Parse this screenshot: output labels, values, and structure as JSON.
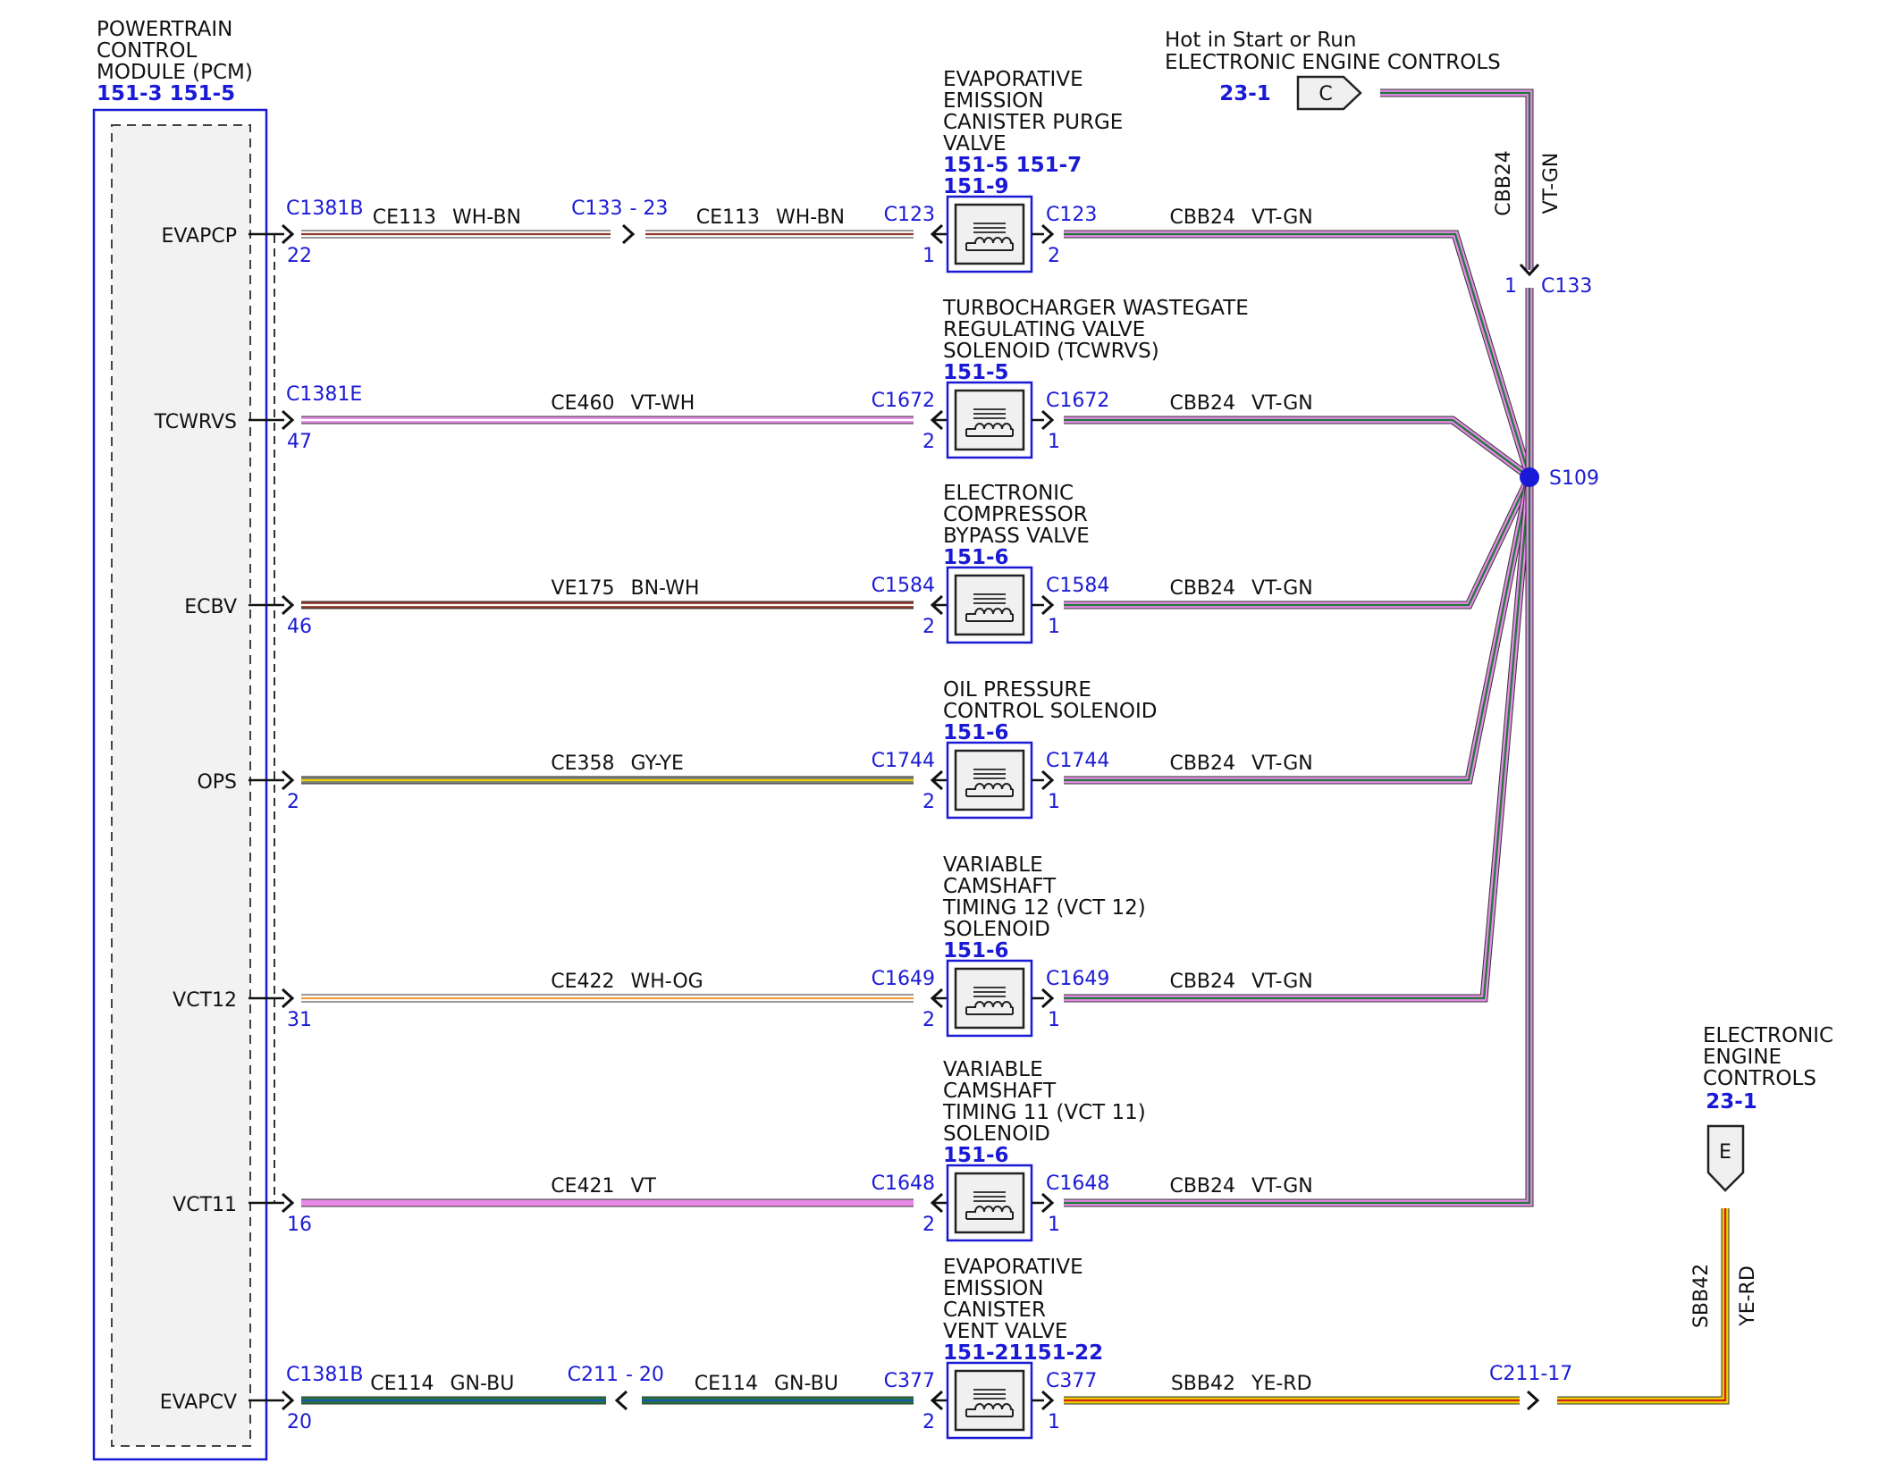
{
  "pcm": {
    "title": [
      "POWERTRAIN",
      "CONTROL",
      "MODULE (PCM)"
    ],
    "refs": "151-3 151-5"
  },
  "wire_colors": {
    "WH": "#ffffff",
    "BN": "#8b3a2a",
    "VT": "#e68ae6",
    "GN": "#1f7a3a",
    "GY": "#808080",
    "YE": "#e8d300",
    "OG": "#f2a040",
    "BU": "#1f4fb0",
    "RD": "#d81f1f"
  },
  "circuits": [
    {
      "pin_label": "EVAPCP",
      "pcm_conn": "C1381B",
      "pcm_pin": "22",
      "segments": [
        {
          "circuit": "CE113",
          "color": "WH-BN"
        },
        {
          "circuit": "CE113",
          "color": "WH-BN"
        }
      ],
      "inline": {
        "name": "C133",
        "pin": "23"
      },
      "component": {
        "name": [
          "EVAPORATIVE",
          "EMISSION",
          "CANISTER PURGE",
          "VALVE"
        ],
        "refs": [
          "151-5 151-7",
          "151-9"
        ],
        "conn": "C123",
        "pin_in": "1",
        "pin_out": "2"
      },
      "return": {
        "circuit": "CBB24",
        "color": "VT-GN"
      }
    },
    {
      "pin_label": "TCWRVS",
      "pcm_conn": "C1381E",
      "pcm_pin": "47",
      "segments": [
        {
          "circuit": "CE460",
          "color": "VT-WH"
        }
      ],
      "component": {
        "name": [
          "TURBOCHARGER WASTEGATE",
          "REGULATING VALVE",
          "SOLENOID (TCWRVS)"
        ],
        "refs": [
          "151-5"
        ],
        "conn": "C1672",
        "pin_in": "2",
        "pin_out": "1"
      },
      "return": {
        "circuit": "CBB24",
        "color": "VT-GN"
      }
    },
    {
      "pin_label": "ECBV",
      "pcm_pin": "46",
      "segments": [
        {
          "circuit": "VE175",
          "color": "BN-WH"
        }
      ],
      "component": {
        "name": [
          "ELECTRONIC",
          "COMPRESSOR",
          "BYPASS VALVE"
        ],
        "refs": [
          "151-6"
        ],
        "conn": "C1584",
        "pin_in": "2",
        "pin_out": "1"
      },
      "return": {
        "circuit": "CBB24",
        "color": "VT-GN"
      }
    },
    {
      "pin_label": "OPS",
      "pcm_pin": "2",
      "segments": [
        {
          "circuit": "CE358",
          "color": "GY-YE"
        }
      ],
      "component": {
        "name": [
          "OIL PRESSURE",
          "CONTROL SOLENOID"
        ],
        "refs": [
          "151-6"
        ],
        "conn": "C1744",
        "pin_in": "2",
        "pin_out": "1"
      },
      "return": {
        "circuit": "CBB24",
        "color": "VT-GN"
      }
    },
    {
      "pin_label": "VCT12",
      "pcm_pin": "31",
      "segments": [
        {
          "circuit": "CE422",
          "color": "WH-OG"
        }
      ],
      "component": {
        "name": [
          "VARIABLE",
          "CAMSHAFT",
          "TIMING 12 (VCT 12)",
          "SOLENOID"
        ],
        "refs": [
          "151-6"
        ],
        "conn": "C1649",
        "pin_in": "2",
        "pin_out": "1"
      },
      "return": {
        "circuit": "CBB24",
        "color": "VT-GN"
      }
    },
    {
      "pin_label": "VCT11",
      "pcm_pin": "16",
      "segments": [
        {
          "circuit": "CE421",
          "color": "VT"
        }
      ],
      "component": {
        "name": [
          "VARIABLE",
          "CAMSHAFT",
          "TIMING 11 (VCT 11)",
          "SOLENOID"
        ],
        "refs": [
          "151-6"
        ],
        "conn": "C1648",
        "pin_in": "2",
        "pin_out": "1"
      },
      "return": {
        "circuit": "CBB24",
        "color": "VT-GN"
      }
    },
    {
      "pin_label": "EVAPCV",
      "pcm_conn": "C1381B",
      "pcm_pin": "20",
      "segments": [
        {
          "circuit": "CE114",
          "color": "GN-BU"
        },
        {
          "circuit": "CE114",
          "color": "GN-BU"
        }
      ],
      "inline": {
        "name": "C211",
        "pin": "20"
      },
      "component": {
        "name": [
          "EVAPORATIVE",
          "EMISSION",
          "CANISTER",
          "VENT VALVE"
        ],
        "refs": [
          "151-21151-22"
        ],
        "conn": "C377",
        "pin_in": "2",
        "pin_out": "1"
      },
      "return": {
        "circuit": "SBB42",
        "color": "YE-RD"
      }
    }
  ],
  "power_feed": {
    "label_1": "Hot in Start or Run",
    "label_2": "ELECTRONIC ENGINE CONTROLS",
    "ref": "23-1",
    "connector_letter": "C",
    "circuit": "CBB24",
    "color": "VT-GN",
    "inline_name": "C133",
    "inline_pin": "1"
  },
  "splice": {
    "name": "S109"
  },
  "vent_feed": {
    "title": [
      "ELECTRONIC",
      "ENGINE",
      "CONTROLS"
    ],
    "ref": "23-1",
    "connector_letter": "E",
    "circuit": "SBB42",
    "color": "YE-RD",
    "inline": "C211-17"
  }
}
